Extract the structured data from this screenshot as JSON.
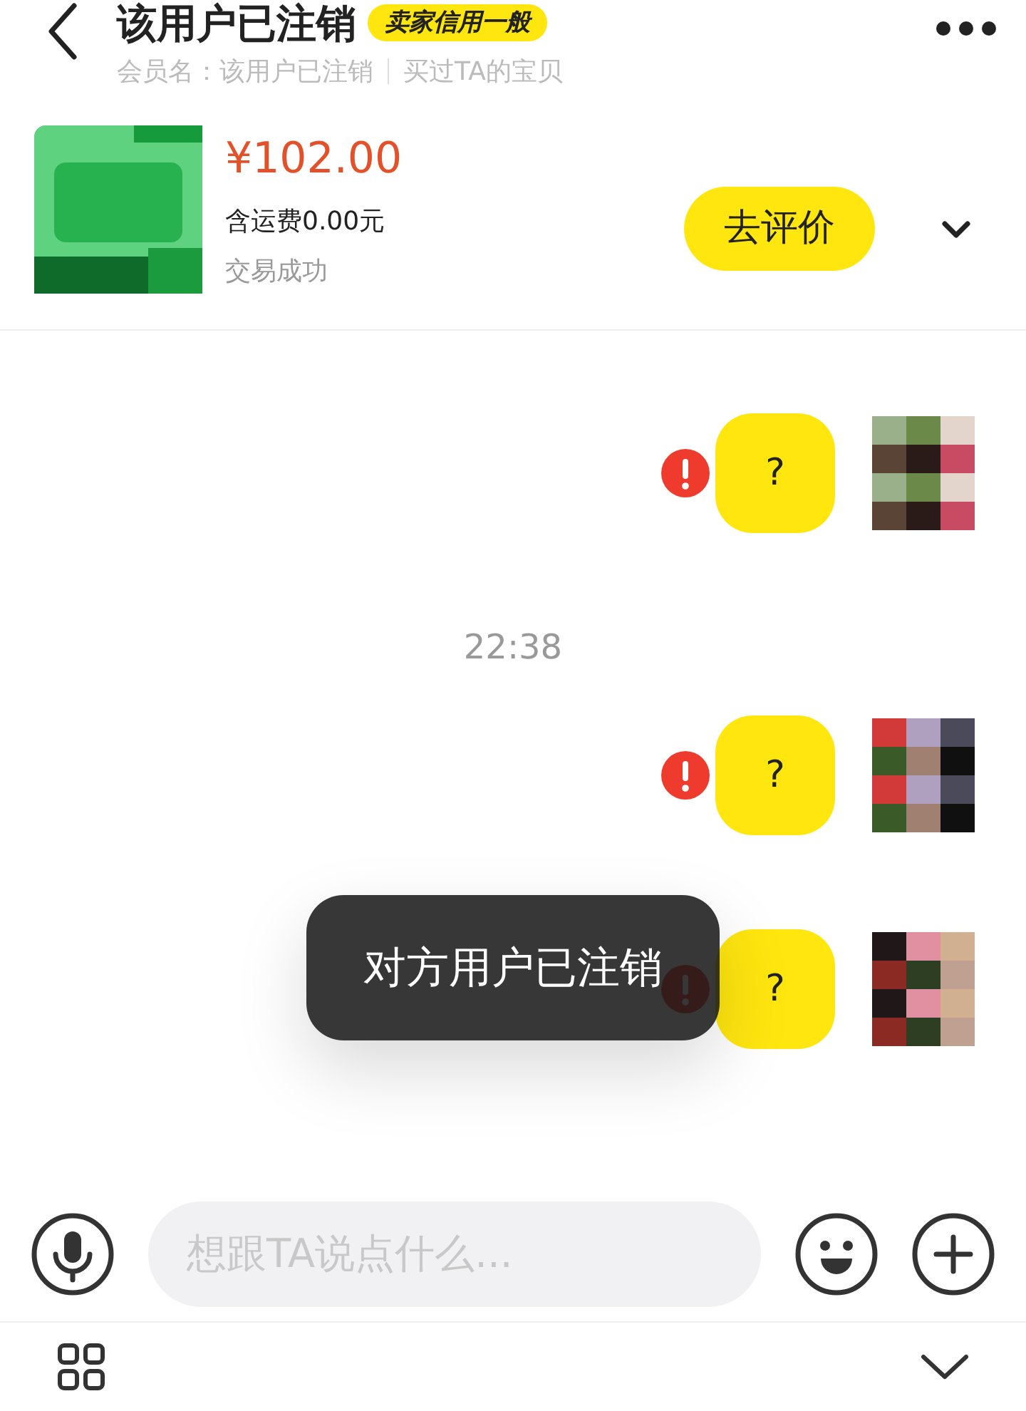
{
  "header": {
    "title": "该用户已注销",
    "credit_badge": "卖家信用一般",
    "member_label": "会员名：该用户已注销",
    "bought_link": "买过TA的宝贝"
  },
  "product": {
    "price": "¥102.00",
    "shipping": "含运费0.00元",
    "status": "交易成功",
    "review_button": "去评价"
  },
  "messages": [
    {
      "kind": "message",
      "text": "?",
      "failed": true
    },
    {
      "kind": "time",
      "text": "22:38"
    },
    {
      "kind": "message",
      "text": "?",
      "failed": true
    },
    {
      "kind": "message",
      "text": "?",
      "failed": true
    }
  ],
  "toast": "对方用户已注销",
  "input": {
    "placeholder": "想跟TA说点什么..."
  }
}
